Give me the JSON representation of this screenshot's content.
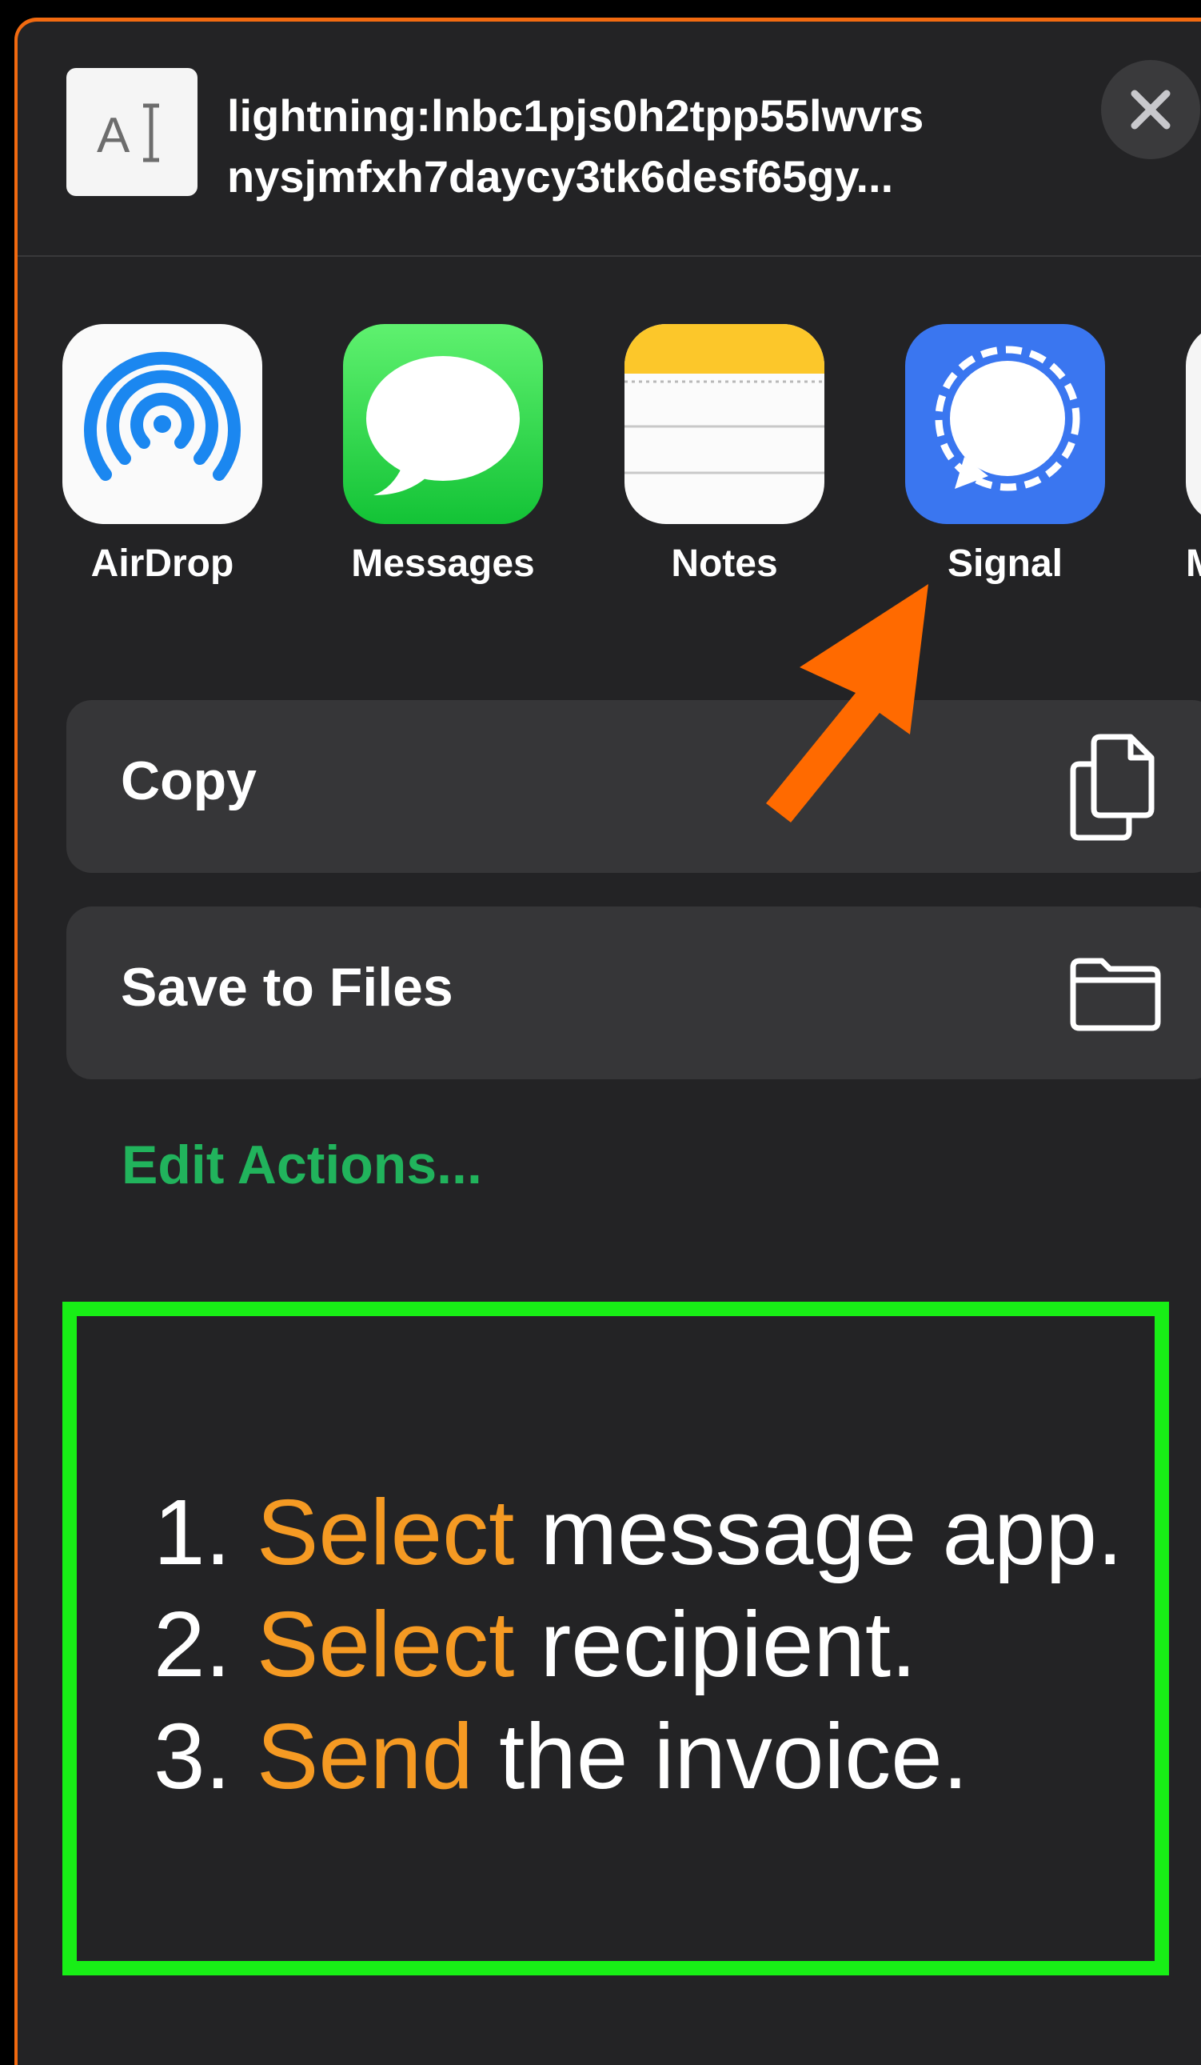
{
  "share_sheet": {
    "link_line1": "lightning:lnbc1pjs0h2tpp55lwvrs",
    "link_line2": "nysjmfxh7daycy3tk6desf65gy...",
    "thumbnail_icon": "text-document-icon",
    "close_icon": "close-icon"
  },
  "apps": [
    {
      "label": "AirDrop",
      "icon": "airdrop-icon"
    },
    {
      "label": "Messages",
      "icon": "messages-icon"
    },
    {
      "label": "Notes",
      "icon": "notes-icon"
    },
    {
      "label": "Signal",
      "icon": "signal-icon"
    },
    {
      "label": "M",
      "icon": "partial-app-icon"
    }
  ],
  "actions": [
    {
      "label": "Copy",
      "icon": "copy-icon"
    },
    {
      "label": "Save to Files",
      "icon": "folder-icon"
    }
  ],
  "edit_actions": "Edit Actions...",
  "instructions": {
    "step1": {
      "num": "1. ",
      "verb": "Select",
      "rest": " message app."
    },
    "step2": {
      "num": "2. ",
      "verb": "Select",
      "rest": " recipient."
    },
    "step3": {
      "num": "3. ",
      "verb": "Send",
      "rest": " the invoice."
    }
  },
  "colors": {
    "annotation_arrow": "#ff6a00",
    "instruction_highlight": "#f59a23",
    "instruction_border": "#18ee16",
    "edit_actions": "#21b35c"
  }
}
